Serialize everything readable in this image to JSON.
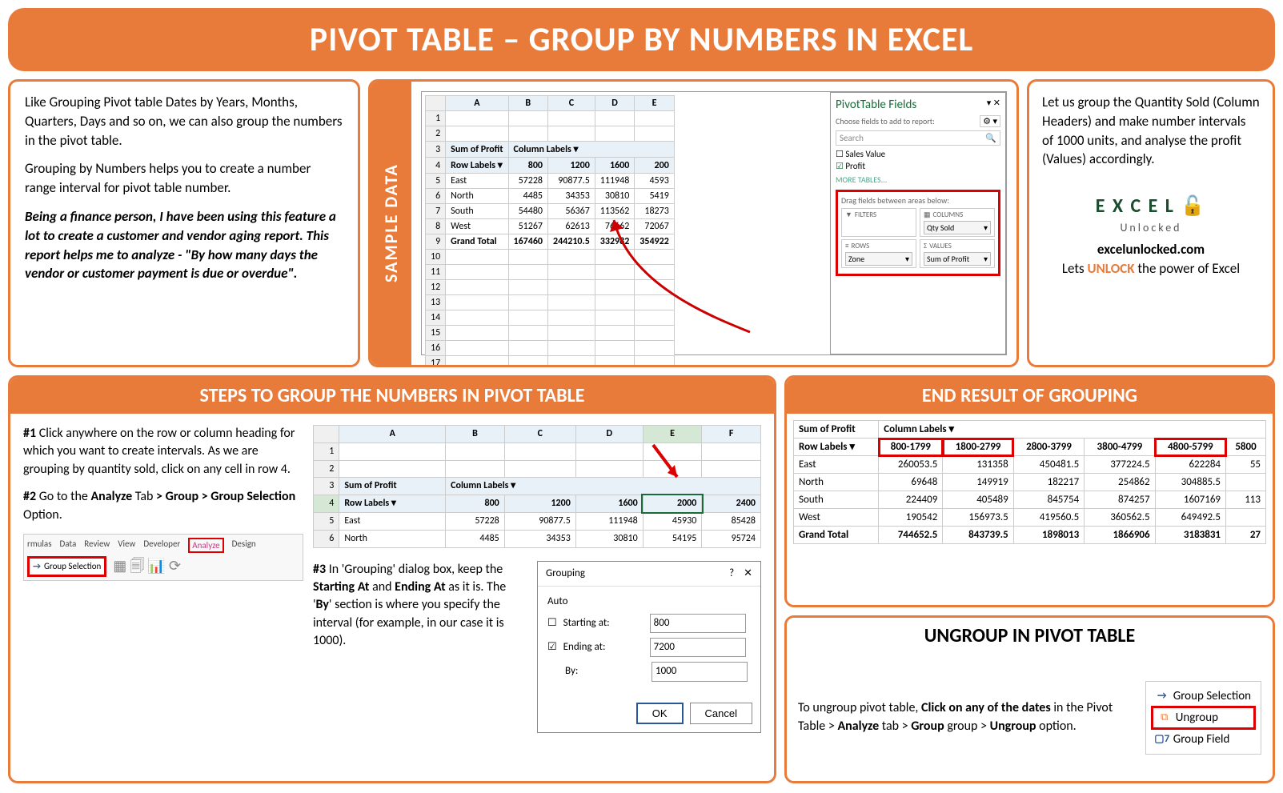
{
  "title": "PIVOT TABLE – GROUP BY NUMBERS IN EXCEL",
  "intro": {
    "p1": "Like Grouping Pivot table Dates by Years, Months, Quarters, Days and so on, we can also group the numbers in the pivot table.",
    "p2": "Grouping by Numbers helps you to create a number range interval for pivot table number.",
    "p3": "Being a finance person, I have been using this feature a lot to create a customer and vendor aging report. This report helps me to analyze - \"By how many days the vendor or customer payment is due or overdue\"."
  },
  "sample_label": "SAMPLE DATA",
  "right": {
    "p1": "Let us group the Quantity Sold (Column Headers) and make number intervals of 1000 units, and analyse the profit (Values) accordingly.",
    "logo_top": "E X C E L",
    "logo_bottom": "Unlocked",
    "site": "excelunlocked.com",
    "tagline_pre": "Lets ",
    "tagline_unlock": "UNLOCK",
    "tagline_post": " the power of Excel"
  },
  "pivot": {
    "corner": "Sum of Profit",
    "col_label": "Column Labels",
    "row_label": "Row Labels",
    "cols": [
      "800",
      "1200",
      "1600",
      "200"
    ],
    "rows": [
      {
        "name": "East",
        "vals": [
          "57228",
          "90877.5",
          "111948",
          "4593"
        ]
      },
      {
        "name": "North",
        "vals": [
          "4485",
          "34353",
          "30810",
          "5419"
        ]
      },
      {
        "name": "South",
        "vals": [
          "54480",
          "56367",
          "113562",
          "18273"
        ]
      },
      {
        "name": "West",
        "vals": [
          "51267",
          "62613",
          "76662",
          "72067"
        ]
      }
    ],
    "grand": "Grand Total",
    "grand_vals": [
      "167460",
      "244210.5",
      "332982",
      "354922"
    ]
  },
  "ptf": {
    "title": "PivotTable Fields",
    "sub": "Choose fields to add to report:",
    "search": "Search",
    "fields": [
      "Sales Value",
      "Profit"
    ],
    "more": "MORE TABLES...",
    "drag": "Drag fields between areas below:",
    "filters": "FILTERS",
    "columns": "COLUMNS",
    "columns_val": "Qty Sold",
    "rows": "ROWS",
    "rows_val": "Zone",
    "values": "VALUES",
    "values_val": "Sum of Profit"
  },
  "steps_header": "STEPS TO GROUP THE NUMBERS IN PIVOT TABLE",
  "step1": {
    "num": "#1",
    "text": " Click anywhere on the row or column heading for which you want to create intervals. As we are grouping by quantity sold, click on any cell in row 4."
  },
  "step2": {
    "num": "#2",
    "t1": " Go to the ",
    "b1": "Analyze",
    "t2": " Tab ",
    "b2": "> Group > Group Selection",
    "t3": " Option."
  },
  "step3": {
    "num": "#3",
    "t1": " In 'Grouping' dialog box, keep the ",
    "b1": "Starting At",
    "t2": " and ",
    "b2": "Ending At",
    "t3": " as it is. The '",
    "b3": "By",
    "t4": "' section is where you specify the interval (for example, in our case it is 1000)."
  },
  "ribbon": {
    "tabs": [
      "rmulas",
      "Data",
      "Review",
      "View",
      "Developer",
      "Analyze",
      "Design"
    ],
    "group_sel": "Group Selection"
  },
  "pivot2": {
    "cols": [
      "800",
      "1200",
      "1600",
      "2000",
      "2400"
    ],
    "rows": [
      {
        "name": "East",
        "vals": [
          "57228",
          "90877.5",
          "111948",
          "45930",
          "85428"
        ]
      },
      {
        "name": "North",
        "vals": [
          "4485",
          "34353",
          "30810",
          "54195",
          "95724"
        ]
      }
    ]
  },
  "dialog": {
    "title": "Grouping",
    "auto": "Auto",
    "start": "Starting at:",
    "start_val": "800",
    "end": "Ending at:",
    "end_val": "7200",
    "by": "By:",
    "by_val": "1000",
    "ok": "OK",
    "cancel": "Cancel"
  },
  "result_header": "END RESULT OF GROUPING",
  "result": {
    "cols": [
      "800-1799",
      "1800-2799",
      "2800-3799",
      "3800-4799",
      "4800-5799",
      "5800"
    ],
    "rows": [
      {
        "name": "East",
        "vals": [
          "260053.5",
          "131358",
          "450481.5",
          "377224.5",
          "622284",
          "55"
        ]
      },
      {
        "name": "North",
        "vals": [
          "69648",
          "149919",
          "182217",
          "254862",
          "304885.5",
          ""
        ]
      },
      {
        "name": "South",
        "vals": [
          "224409",
          "405489",
          "845754",
          "874257",
          "1607169",
          "113"
        ]
      },
      {
        "name": "West",
        "vals": [
          "190542",
          "156973.5",
          "419560.5",
          "360562.5",
          "649492.5",
          ""
        ]
      }
    ],
    "grand": "Grand Total",
    "grand_vals": [
      "744652.5",
      "843739.5",
      "1898013",
      "1866906",
      "3183831",
      "27"
    ]
  },
  "ungroup_header": "UNGROUP IN PIVOT TABLE",
  "ungroup": {
    "t1": "To ungroup pivot table, ",
    "b1": "Click on any of the dates",
    "t2": " in the Pivot Table > ",
    "b2": "Analyze",
    "t3": " tab > ",
    "b3": "Group",
    "t4": " group > ",
    "b4": "Ungroup",
    "t5": " option."
  },
  "menu": {
    "i1": "Group Selection",
    "i2": "Ungroup",
    "i3": "Group Field"
  }
}
